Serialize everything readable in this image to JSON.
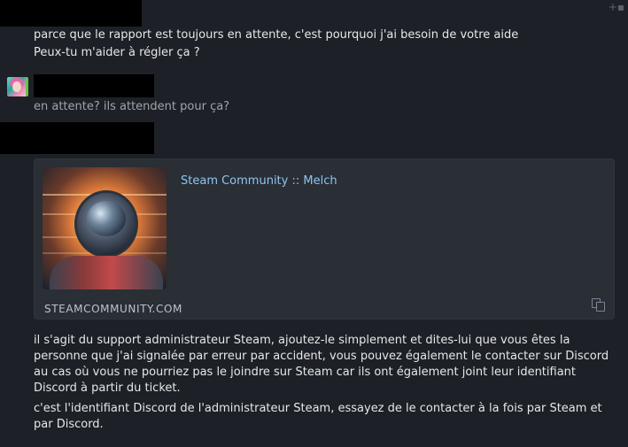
{
  "messages": {
    "m1_line1": "parce que le rapport est toujours en attente, c'est pourquoi j'ai besoin de votre aide",
    "m1_line2": "Peux-tu m'aider à régler ça ?",
    "m2": "en attente? ils attendent pour ça?",
    "m3": "il s'agit du support administrateur Steam, ajoutez-le simplement et dites-lui que vous êtes la\npersonne que j'ai signalée par erreur par accident, vous pouvez également le contacter sur Discord\nau cas où vous ne pourriez pas le joindre sur Steam car ils ont également joint leur identifiant\nDiscord à partir du ticket.",
    "m4": "c'est l'identifiant Discord de l'administrateur Steam, essayez de le contacter à la fois par Steam et\npar Discord."
  },
  "embed": {
    "title": "Steam Community :: Melch",
    "domain": "STEAMCOMMUNITY.COM"
  },
  "icons": {
    "copy": "copy-icon",
    "add": "add-reaction-icon",
    "avatar": "avatar"
  },
  "colors": {
    "background": "#1d2026",
    "embed_bg": "#2a2e35",
    "link": "#8ec6f2"
  }
}
